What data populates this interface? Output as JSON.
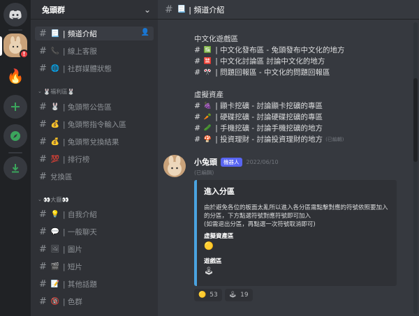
{
  "server_name": "兔頭群",
  "header_chevron": "⌄",
  "rail": {
    "badge": "!"
  },
  "sidebar": {
    "hash": "#",
    "channels_top": [
      {
        "emoji": "📃",
        "label": "| 頻道介紹",
        "active": true
      },
      {
        "emoji": "📞",
        "label": "| 線上客服"
      },
      {
        "emoji": "🌐",
        "label": "| 社群媒體狀態"
      }
    ],
    "category1": "🐰福利區🐰",
    "channels_welfare": [
      {
        "emoji": "🐰",
        "label": "| 兔頭幣公告區"
      },
      {
        "emoji": "💰",
        "label": "| 兔頭幣指令輸入區"
      },
      {
        "emoji": "💰",
        "label": "| 兔頭幣兌換結果"
      },
      {
        "emoji": "💯",
        "label": "| 排行榜"
      },
      {
        "emoji": "",
        "label": "兌換區"
      }
    ],
    "category2": "👀大廳👀",
    "channels_lobby": [
      {
        "emoji": "💡",
        "label": "| 自我介紹"
      },
      {
        "emoji": "💬",
        "label": "| 一般聊天"
      },
      {
        "emoji": "🖼",
        "label": "| 圖片"
      },
      {
        "emoji": "🎬",
        "label": "| 短片"
      },
      {
        "emoji": "📝",
        "label": "| 其他話題"
      },
      {
        "emoji": "🔞",
        "label": "| 色群"
      }
    ]
  },
  "topbar": {
    "hash": "#",
    "emoji": "📃",
    "title": "| 頻道介紹"
  },
  "content": {
    "group1_title": "中文化遊戲區",
    "group1": [
      {
        "emoji": "🈯",
        "text": "| 中文化發布區 - 兔頭發布中文化的地方"
      },
      {
        "emoji": "🈲",
        "text": "| 中文化討論區 討論中文化的地方"
      },
      {
        "emoji": "🎌",
        "text": "| 問題回報區 - 中文化的問題回報區"
      }
    ],
    "group2_title": "虛擬資產",
    "group2": [
      {
        "emoji": "🍇",
        "text": "| 顯卡挖礦 - 討論顯卡挖礦的專區"
      },
      {
        "emoji": "🥕",
        "text": "| 硬碟挖礦 - 討論硬碟挖礦的專區"
      },
      {
        "emoji": "🥒",
        "text": "| 手機挖礦 - 討論手機挖礦的地方"
      },
      {
        "emoji": "🍄",
        "text": "| 投資理財 - 討論投資理財的地方",
        "sub": "(已編輯)"
      }
    ]
  },
  "message": {
    "author": "小兔頭",
    "role": "機器人",
    "timestamp": "2022/06/10",
    "edited": "(已編輯)",
    "embed": {
      "title": "進入分區",
      "desc": "由於避免各位的板面太亂所以進入各分區需點擊對應的符號依照要加入的分區，下方點選符號對應符號即可加入\n(如需退出分區，再點選一次符號取消即可)",
      "field1_name": "虛擬資產區",
      "field1_value": "🟡",
      "field2_name": "遊戲區",
      "field2_value": "🕹"
    },
    "reactions": [
      {
        "emoji": "🟡",
        "count": "53"
      },
      {
        "emoji": "🕹",
        "count": "19"
      }
    ]
  }
}
